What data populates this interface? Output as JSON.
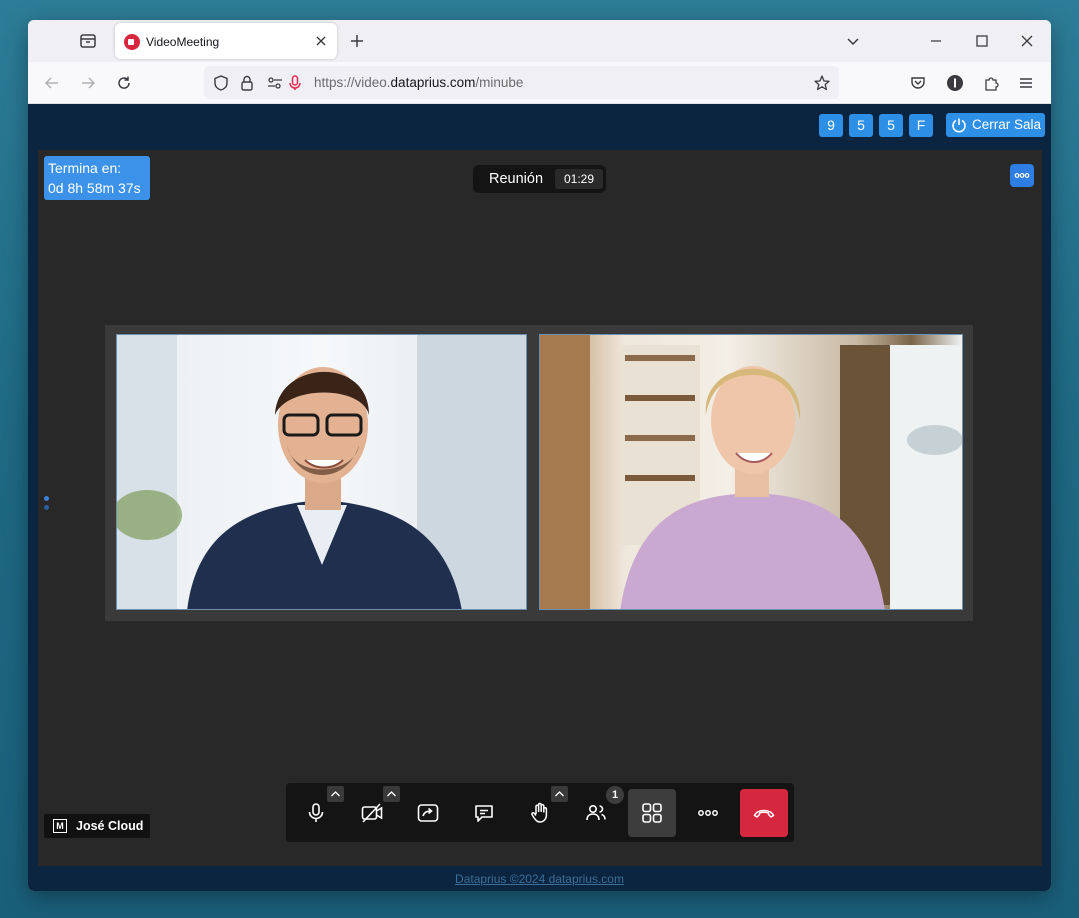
{
  "browser": {
    "tab_title": "VideoMeeting",
    "url_prefix": "https://video.",
    "url_domain": "dataprius.com",
    "url_path": "/minube"
  },
  "header": {
    "badges": [
      "9",
      "5",
      "5",
      "F"
    ],
    "close_room_label": "Cerrar Sala"
  },
  "meeting": {
    "ends_label": "Termina en:",
    "ends_value": "0d 8h 58m 37s",
    "name": "Reunión",
    "elapsed": "01:29",
    "participant_count": "1",
    "local_user_initial": "M",
    "local_user_name": "José Cloud"
  },
  "footer": {
    "text": "Dataprius ©2024 dataprius.com"
  },
  "colors": {
    "accent": "#2d8fe6",
    "hangup": "#d5283f",
    "page_bg": "#0b2540",
    "stage_bg": "#282828"
  },
  "icons": [
    "tab-list-icon",
    "videomeeting-favicon",
    "close-icon",
    "plus-icon",
    "chevron-down-icon",
    "minimize-icon",
    "maximize-icon",
    "back-icon",
    "forward-icon",
    "reload-icon",
    "shield-icon",
    "lock-icon",
    "permissions-icon",
    "microphone-icon",
    "star-icon",
    "pocket-icon",
    "extensions-icon",
    "menu-icon",
    "power-icon",
    "more-icon",
    "camera-off-icon",
    "share-screen-icon",
    "chat-icon",
    "raise-hand-icon",
    "participants-icon",
    "tile-view-icon",
    "hangup-icon"
  ]
}
